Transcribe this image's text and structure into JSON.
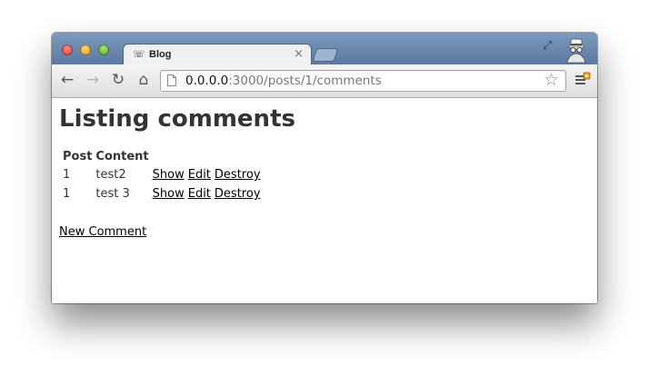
{
  "browser": {
    "tab": {
      "title": "Blog",
      "favicon": "☏",
      "close": "×"
    },
    "address": {
      "host": "0.0.0.0",
      "rest": ":3000/posts/1/comments"
    },
    "icons": {
      "back": "←",
      "forward": "→",
      "reload": "↻",
      "home": "⌂",
      "star": "☆",
      "fullscreen": "⤢"
    }
  },
  "page": {
    "title": "Listing comments",
    "table": {
      "headers": [
        "Post",
        "Content"
      ],
      "rows": [
        {
          "post": "1",
          "content": "test2",
          "actions": [
            "Show",
            "Edit",
            "Destroy"
          ]
        },
        {
          "post": "1",
          "content": "test 3",
          "actions": [
            "Show",
            "Edit",
            "Destroy"
          ]
        }
      ]
    },
    "new_link": "New Comment"
  }
}
